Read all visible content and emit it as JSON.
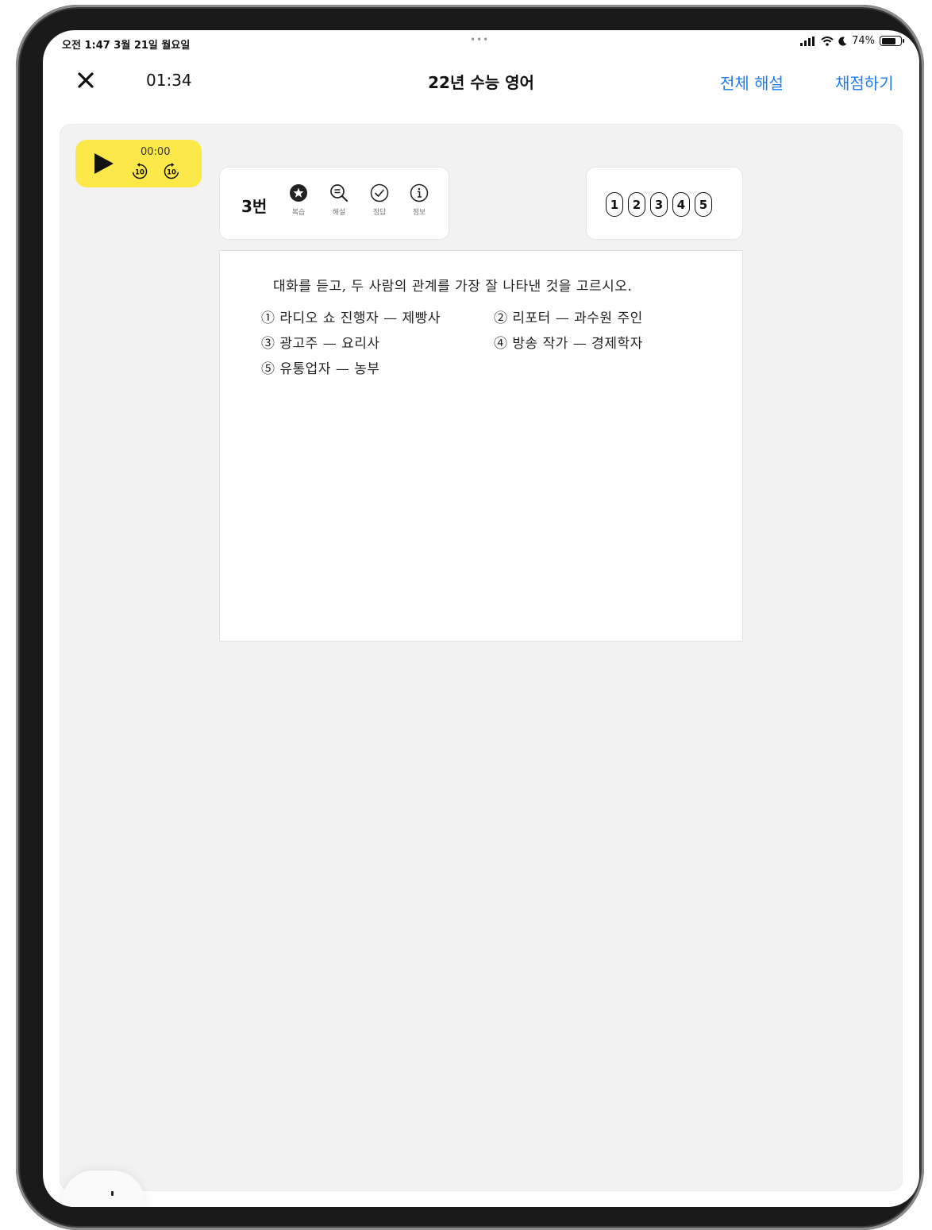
{
  "status_bar": {
    "time_date": "오전 1:47   3월 21일 월요일",
    "dots": "•••",
    "battery": "74%",
    "icons": [
      "signal-icon",
      "wifi-icon",
      "moon-icon",
      "battery-icon"
    ]
  },
  "nav": {
    "close_icon": "close-icon",
    "timer": "01:34",
    "title": "22년 수능 영어",
    "solution_label": "전체 해설",
    "grade_label": "채점하기",
    "link_color": "#1e7cf2"
  },
  "player": {
    "time": "00:00",
    "skip_back_label": "10",
    "skip_forward_label": "10",
    "background": "#fde84a"
  },
  "question": {
    "number": "3번",
    "tools": [
      {
        "icon": "star-icon",
        "label": "복습"
      },
      {
        "icon": "search-list-icon",
        "label": "해설"
      },
      {
        "icon": "check-circle-icon",
        "label": "정답"
      },
      {
        "icon": "info-icon",
        "label": "정보"
      }
    ],
    "answer_choices": [
      "1",
      "2",
      "3",
      "4",
      "5"
    ],
    "prompt": "대화를 듣고, 두 사람의 관계를 가장 잘 나타낸 것을 고르시오.",
    "options": [
      "① 라디오 쇼 진행자 — 제빵사",
      "② 리포터 — 과수원 주인",
      "③ 광고주 — 요리사",
      "④ 방송 작가 — 경제학자",
      "⑤ 유통업자 — 농부"
    ]
  }
}
